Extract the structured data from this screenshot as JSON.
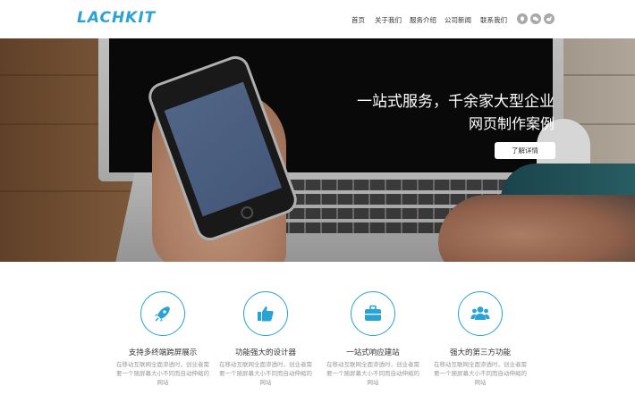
{
  "header": {
    "logo": "LACHKIT",
    "nav": [
      {
        "label": "首页"
      },
      {
        "label": "关于我们"
      },
      {
        "label": "服务介绍"
      },
      {
        "label": "公司新闻"
      },
      {
        "label": "联系我们"
      }
    ],
    "social_icons": [
      "qq-icon",
      "wechat-icon",
      "weibo-icon"
    ]
  },
  "hero": {
    "title_line1": "一站式服务，千余家大型企业",
    "title_line2": "网页制作案例",
    "button_label": "了解详情"
  },
  "features": [
    {
      "icon": "rocket-icon",
      "title": "支持多终端跨屏展示",
      "desc": "在移动互联网全面渗透时，创业者需要一个随屏幕大小不同而自动伸缩的网站"
    },
    {
      "icon": "thumbs-up-icon",
      "title": "功能强大的设计器",
      "desc": "在移动互联网全面渗透时，创业者需要一个随屏幕大小不同而自动伸缩的网站"
    },
    {
      "icon": "briefcase-icon",
      "title": "一站式响应建站",
      "desc": "在移动互联网全面渗透时，创业者需要一个随屏幕大小不同而自动伸缩的网站"
    },
    {
      "icon": "users-icon",
      "title": "强大的第三方功能",
      "desc": "在移动互联网全面渗透时，创业者需要一个随屏幕大小不同而自动伸缩的网站"
    }
  ],
  "colors": {
    "accent": "#29a3d6",
    "icon_gray": "#a9a9a9"
  }
}
